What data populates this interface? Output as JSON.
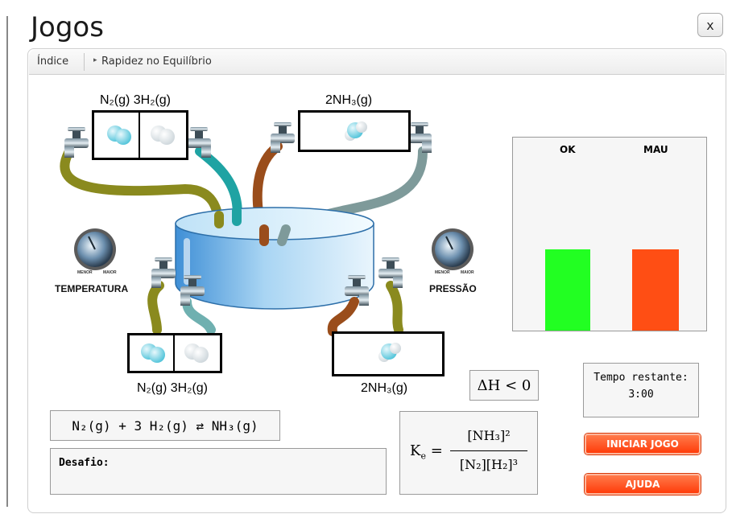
{
  "window": {
    "title": "Jogos",
    "close_label": "x"
  },
  "breadcrumb": {
    "index": "Índice",
    "current": "Rapidez no Equilíbrio"
  },
  "top_left_box": {
    "label_a": "N₂(g)",
    "label_b": "3H₂(g)"
  },
  "top_right_box": {
    "label": "2NH₃(g)"
  },
  "bottom_left_box": {
    "label_a": "N₂(g)",
    "label_b": "3H₂(g)"
  },
  "bottom_right_box": {
    "label": "2NH₃(g)"
  },
  "temperature": {
    "label": "TEMPERATURA",
    "min": "MENOR",
    "max": "MAIOR"
  },
  "pressure": {
    "label": "PRESSÃO",
    "min": "MENOR",
    "max": "MAIOR"
  },
  "score_chart": {
    "ok_label": "OK",
    "mau_label": "MAU",
    "ok_value": 0.42,
    "mau_value": 0.42,
    "ok_color": "#22ff22",
    "mau_color": "#ff4e14"
  },
  "enthalpy": "ΔH < 0",
  "timer": {
    "label": "Tempo restante:",
    "value": "3:00"
  },
  "equation": "N₂(g) + 3 H₂(g) ⇄ NH₃(g)",
  "challenge": {
    "label": "Desafio:"
  },
  "ke": {
    "symbol": "K",
    "sub": "e",
    "eq": "=",
    "numerator": "[NH₃]²",
    "denominator": "[N₂][H₂]³"
  },
  "buttons": {
    "start": "INICIAR JOGO",
    "help": "AJUDA",
    "accent": "#ff4e14"
  },
  "icons": {
    "faucet": "faucet-icon",
    "molecule": "molecule-icon",
    "knob": "knob-icon",
    "tank": "tank-icon"
  }
}
